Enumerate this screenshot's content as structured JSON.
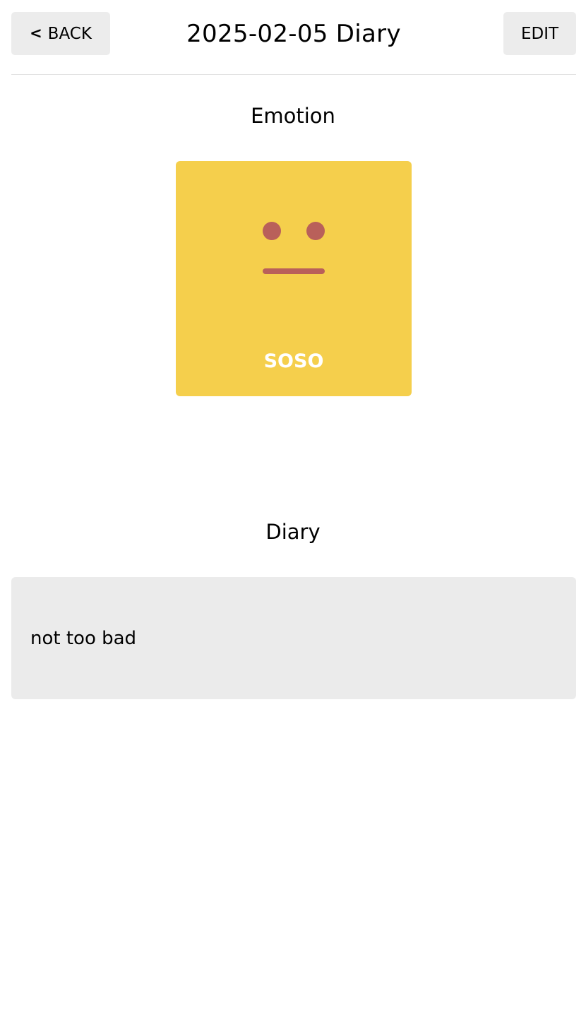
{
  "header": {
    "back_label": "BACK",
    "back_icon": "chevron-left-icon",
    "title": "2025-02-05 Diary",
    "edit_label": "EDIT"
  },
  "emotion": {
    "section_title": "Emotion",
    "label": "SOSO",
    "icon": "neutral-face-icon",
    "card_color": "#f5cf4c",
    "face_color": "#b9605a",
    "label_color": "#ffffff"
  },
  "diary": {
    "section_title": "Diary",
    "content": "not too bad",
    "box_color": "#ebebeb"
  }
}
